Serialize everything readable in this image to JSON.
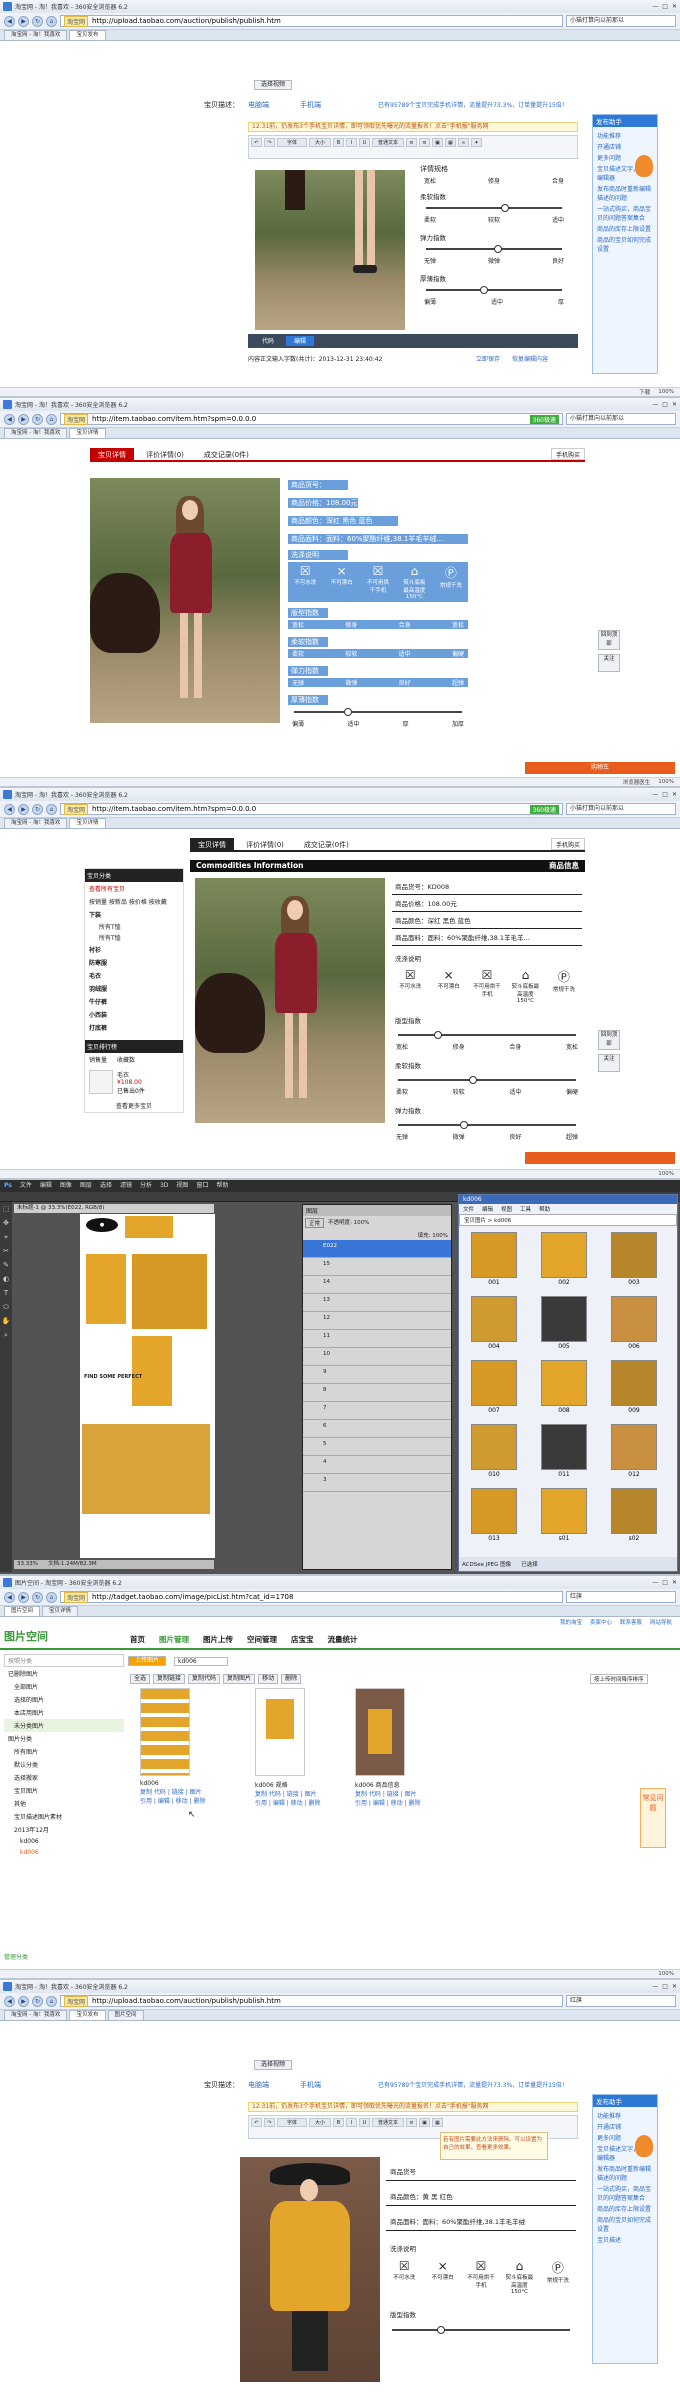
{
  "p1": {
    "title": "淘宝网 - 淘！我喜欢 - 360安全浏览器 6.2",
    "url": "http://upload.taobao.com/auction/publish/publish.htm",
    "site_tag": "淘宝网",
    "search": "小猫打算向以前那以",
    "tabs": [
      "淘宝网 - 淘！我喜欢",
      "宝贝发布"
    ],
    "preview_label": "选择视频",
    "desc_label": "宝贝描述：",
    "tab_pc": "电脑端",
    "tab_mobile": "手机端",
    "mobile_hint": "已有95789个宝贝完成手机详情，流量提升73.3%，订单量提升15倍！",
    "notice": "12.31前，仍发布3个手机宝贝详情，即可领取优先曝光的流量报名！点击\"手机报\"服务网",
    "editor_font": "字体",
    "editor_size": "大小",
    "editor_format": "普通文本",
    "spec_heading": "详情规格",
    "spec": {
      "soft_label": "柔软指数",
      "soft_ticks": [
        "柔软",
        "较软",
        "适中"
      ],
      "elastic_label": "弹力指数",
      "elastic_ticks": [
        "无弹",
        "微弹",
        "良好"
      ],
      "thick_label": "厚薄指数",
      "thick_ticks": [
        "偏薄",
        "适中",
        "厚"
      ]
    },
    "fit_ticks": [
      "宽松",
      "修身",
      "合身"
    ],
    "code_tabs": [
      "代码",
      "编辑"
    ],
    "footer": "内容正文输入字数(共计)：2013-12-31 23:40:42",
    "save_draft": "立即保存",
    "save_extra": "恢复编辑内容"
  },
  "p2": {
    "title": "淘宝网 - 淘！我喜欢 - 360安全浏览器 6.2",
    "url": "http://item.taobao.com/item.htm?spm=0.0.0.0",
    "site_tag": "淘宝网",
    "go_label": "360极速",
    "search": "小猫打算向以前那以",
    "tabs": [
      "淘宝网 - 淘！我喜欢",
      "宝贝详情"
    ],
    "product_tabs": [
      "宝贝详情",
      "评价详情(0)",
      "成交记录(0件)"
    ],
    "phone_btn": "手机购买",
    "rows": [
      "商品货号：KD008",
      "商品价格：108.00元",
      "商品颜色：深红 黑色 蓝色",
      "商品面料：面料：60%聚酯纤维,38.1羊毛羊绒..."
    ],
    "wash_label": "洗涤说明",
    "wash_icons": [
      {
        "sym": "☒",
        "text": "不可水洗"
      },
      {
        "sym": "⨯",
        "text": "不可漂白"
      },
      {
        "sym": "☒",
        "text": "不可用烘干手机"
      },
      {
        "sym": "⌂",
        "text": "熨斗底板最高温度150°C"
      },
      {
        "sym": "Ⓟ",
        "text": "常规干洗"
      }
    ],
    "fit_label": "版型指数",
    "fit_ticks": [
      "宽松",
      "修身",
      "合身",
      "宽松"
    ],
    "soft_label": "柔软指数",
    "soft_ticks": [
      "柔软",
      "较软",
      "适中",
      "偏硬"
    ],
    "elastic_label": "弹力指数",
    "elastic_ticks": [
      "无弹",
      "微弹",
      "良好",
      "超弹"
    ],
    "thick_label": "厚薄指数",
    "thick_ticks": [
      "偏薄",
      "适中",
      "厚",
      "加厚"
    ],
    "side_btns": [
      "回到顶部",
      "关注"
    ],
    "orange_btn": "购物车",
    "status": "浏览器医生"
  },
  "p3": {
    "title": "淘宝网 - 淘！我喜欢 - 360安全浏览器 6.2",
    "url": "http://item.taobao.com/item.htm?spm=0.0.0.0",
    "site_tag": "淘宝网",
    "go_label": "360极速",
    "search": "小猫打算向以前那以",
    "tabs": [
      "淘宝网 - 淘！我喜欢",
      "宝贝详情"
    ],
    "sidebar_header": "宝贝分类",
    "sidebar_items": [
      "查看所有宝贝",
      "按销量 按新品 按价格 按收藏",
      "下装",
      "所有T恤",
      "所有T恤",
      "衬衫",
      "防寒服",
      "毛衣",
      "羽绒服",
      "牛仔裤",
      "小西装",
      "打底裤"
    ],
    "rank_header": "宝贝排行榜",
    "rank_tabs": [
      "销售量",
      "收藏数"
    ],
    "rank_item_name": "毛衣",
    "rank_price": "¥108.00",
    "rank_sold": "已售出0件",
    "rank_more": "查看更多宝贝",
    "product_tabs": [
      "宝贝详情",
      "评价详情(0)",
      "成交记录(0件)"
    ],
    "banner_en": "Commodities Information",
    "banner_cn": "商品信息",
    "rows": [
      "商品货号：KD008",
      "商品价格：108.00元",
      "商品颜色：深红 黑色 蓝色",
      "商品面料：面料：60%聚酯纤维,38.1羊毛羊..."
    ],
    "wash_label": "洗涤说明",
    "wash_icons": [
      {
        "sym": "☒",
        "text": "不可水洗"
      },
      {
        "sym": "⨯",
        "text": "不可漂白"
      },
      {
        "sym": "☒",
        "text": "不可用烘干手机"
      },
      {
        "sym": "⌂",
        "text": "熨斗底板最高温度150°C"
      },
      {
        "sym": "Ⓟ",
        "text": "常规干洗"
      }
    ],
    "fit_label": "版型指数",
    "fit_ticks": [
      "宽松",
      "修身",
      "合身",
      "宽松"
    ],
    "soft_label": "柔软指数",
    "soft_ticks": [
      "柔软",
      "较软",
      "适中",
      "偏硬"
    ],
    "elastic_label": "弹力指数",
    "elastic_ticks": [
      "无弹",
      "微弹",
      "良好",
      "超弹"
    ],
    "phone_btn": "手机购买",
    "side_btns": [
      "回到顶部",
      "关注"
    ]
  },
  "p4": {
    "ps_menu": [
      "文件",
      "编辑",
      "图像",
      "图层",
      "选择",
      "滤镜",
      "分析",
      "3D",
      "视图",
      "窗口",
      "帮助"
    ],
    "ps_tab": "未标题-1 @ 33.3%(E022, RGB/8)",
    "ps_zoom": "33.33%",
    "ps_docsize": "文档:1.24M/82.3M",
    "layers_tab": "图层",
    "layers_mode": "正常",
    "layers_opacity": "不透明度: 100%",
    "layers_fill": "填充: 100%",
    "layer_names": [
      "E022",
      "15",
      "14",
      "13",
      "12",
      "11",
      "10",
      "9",
      "8",
      "7",
      "6",
      "5",
      "4",
      "3"
    ],
    "banner_text": "FIND SOME PERFECT",
    "acdsee_title": "kd006",
    "acdsee_menu": [
      "文件",
      "编辑",
      "视图",
      "工具",
      "帮助"
    ],
    "acdsee_breadcrumb": "宝贝图片 > kd006",
    "acdsee_thumbs": [
      "001",
      "002",
      "003",
      "004",
      "005",
      "006",
      "007",
      "008",
      "009",
      "010",
      "011",
      "012",
      "013",
      "s01",
      "s02"
    ],
    "acdsee_status": "ACDSee JPEG 图像",
    "acdsee_count": "已选择"
  },
  "p5": {
    "title": "图片空间 - 淘宝网 - 360安全浏览器 6.2",
    "url": "http://tadget.taobao.com/image/picList.htm?cat_id=1708",
    "site_tag": "淘宝网",
    "search": "红旗",
    "tabs": [
      "图片空间",
      "宝贝详情"
    ],
    "top_links": [
      "我的淘宝",
      "卖家中心",
      "联系客服",
      "网站导航"
    ],
    "logo": "图片空间",
    "nav": [
      "首页",
      "图片管理",
      "图片上传",
      "空间管理",
      "店宝宝",
      "流量统计"
    ],
    "left_section": "按照分类",
    "left_items": [
      "已删除图片",
      "全部图片",
      "选择的图片",
      "本店用图片",
      "未分类图片",
      "图片分类",
      "所有图片",
      "默认分类",
      "选择搬家",
      "宝贝图片",
      "其他",
      "宝贝描述图片素材",
      "2013年12月",
      "kd006",
      "kd006"
    ],
    "upload_btn": "上传图片",
    "filter_select": "kd006",
    "toolbar_btns": [
      "全选",
      "复制链接",
      "复制代码",
      "复制图片",
      "移动",
      "删除"
    ],
    "sort_label": "按上传时间降序排序",
    "images": [
      {
        "name": "kd006",
        "links": "复制 代码 | 链接 | 图片",
        "actions": "引用 | 编辑 | 移动 | 删除"
      },
      {
        "name": "kd006 规格",
        "links": "复制 代码 | 链接 | 图片",
        "actions": "引用 | 编辑 | 移动 | 删除"
      },
      {
        "name": "kd006 商品信息",
        "links": "复制 代码 | 链接 | 图片",
        "actions": "引用 | 编辑 | 移动 | 删除"
      }
    ],
    "manage_link": "管理分类",
    "helper": "常见问题"
  },
  "p6": {
    "title": "淘宝网 - 淘！我喜欢 - 360安全浏览器 6.2",
    "url": "http://upload.taobao.com/auction/publish/publish.htm",
    "site_tag": "淘宝网",
    "search": "红旗",
    "tabs": [
      "淘宝网 - 淘！我喜欢",
      "宝贝发布",
      "图片空间"
    ],
    "preview_label": "选择视频",
    "desc_label": "宝贝描述：",
    "tab_pc": "电脑端",
    "tab_mobile": "手机端",
    "mobile_hint": "已有95789个宝贝完成手机详情，流量提升73.3%，订单量提升15倍！",
    "notice": "12.31前，仍发布3个手机宝贝详情，即可领取优先曝光的流量报名！点击\"手机报\"服务网",
    "editor_font": "字体",
    "editor_size": "大小",
    "editor_format": "普通文本",
    "tooltip": "若有图片需要此方法来删除。可以设置为自己的效果，查看更多效果。",
    "rows": [
      "商品货号",
      "商品颜色：黄 黑 红色",
      "商品面料：面料：60%聚酯纤维,38.1羊毛羊绒"
    ],
    "wash_label": "洗涤说明",
    "wash_icons": [
      {
        "sym": "☒",
        "text": "不可水洗"
      },
      {
        "sym": "⨯",
        "text": "不可漂白"
      },
      {
        "sym": "☒",
        "text": "不可用烘干手机"
      },
      {
        "sym": "⌂",
        "text": "熨斗底板最高温度150°C"
      },
      {
        "sym": "Ⓟ",
        "text": "常规干洗"
      }
    ],
    "fit_label": "版型指数"
  },
  "help_box": {
    "header": "发布助手",
    "tag": "功能推荐",
    "items": [
      "开通店铺",
      "更多问题",
      "宝贝描述文字，图片编辑器",
      "发布商品时重新编辑描述的问题",
      "一站式购买，商品宝贝的问题答案集合",
      "商品的库存上限设置",
      "商品的宝贝如何完成设置",
      "宝贝描述"
    ]
  }
}
